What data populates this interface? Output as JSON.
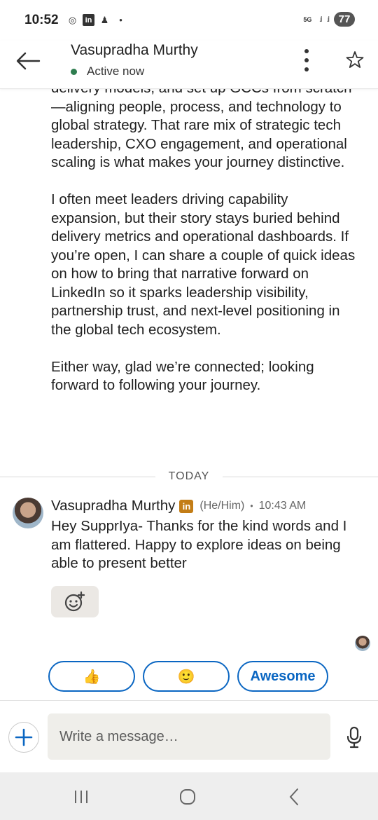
{
  "status_bar": {
    "time": "10:52",
    "battery": "77",
    "network": "5G"
  },
  "header": {
    "name": "Vasupradha Murthy",
    "presence": "Active now"
  },
  "conversation": {
    "earlier_paragraphs": [
      "expanding delivery, …, and set up GCCs from scratch—aligning people, process, and technology to global strategy. That rare mix of strategic tech leadership, CXO engagement, and operational scaling is what makes your journey distinctive.",
      "I often meet leaders driving capability expansion, but their story stays buried behind delivery metrics and operational dashboards. If you’re open, I can share a couple of quick ideas on how to bring that narrative forward on LinkedIn so it sparks leadership visibility, partnership trust, and next-level positioning in the global tech ecosystem.",
      "Either way, glad we’re connected; looking forward to following your journey."
    ],
    "partial_top_line": "delivery models, and set up GCCs from",
    "para1_rest": "scratch—aligning people, process, and technology to global strategy. That rare mix of strategic tech leadership, CXO engagement, and operational scaling is what makes your journey distinctive.",
    "date_divider": "TODAY",
    "latest": {
      "sender": "Vasupradha Murthy",
      "badge": "in",
      "pronouns": "(He/Him)",
      "separator": "•",
      "time": "10:43 AM",
      "text": "Hey SupprIya- Thanks for the kind words and I am flattered.  Happy to explore ideas on being able to present better"
    }
  },
  "quick_replies": [
    {
      "label": "👍",
      "icon": "thumbs-up-icon"
    },
    {
      "label": "🙂",
      "icon": "smile-icon"
    },
    {
      "label": "Awesome"
    }
  ],
  "composer": {
    "placeholder": "Write a message…"
  },
  "colors": {
    "accent": "#0a66c2",
    "presence": "#2e7d4f",
    "badge": "#c37d16"
  }
}
